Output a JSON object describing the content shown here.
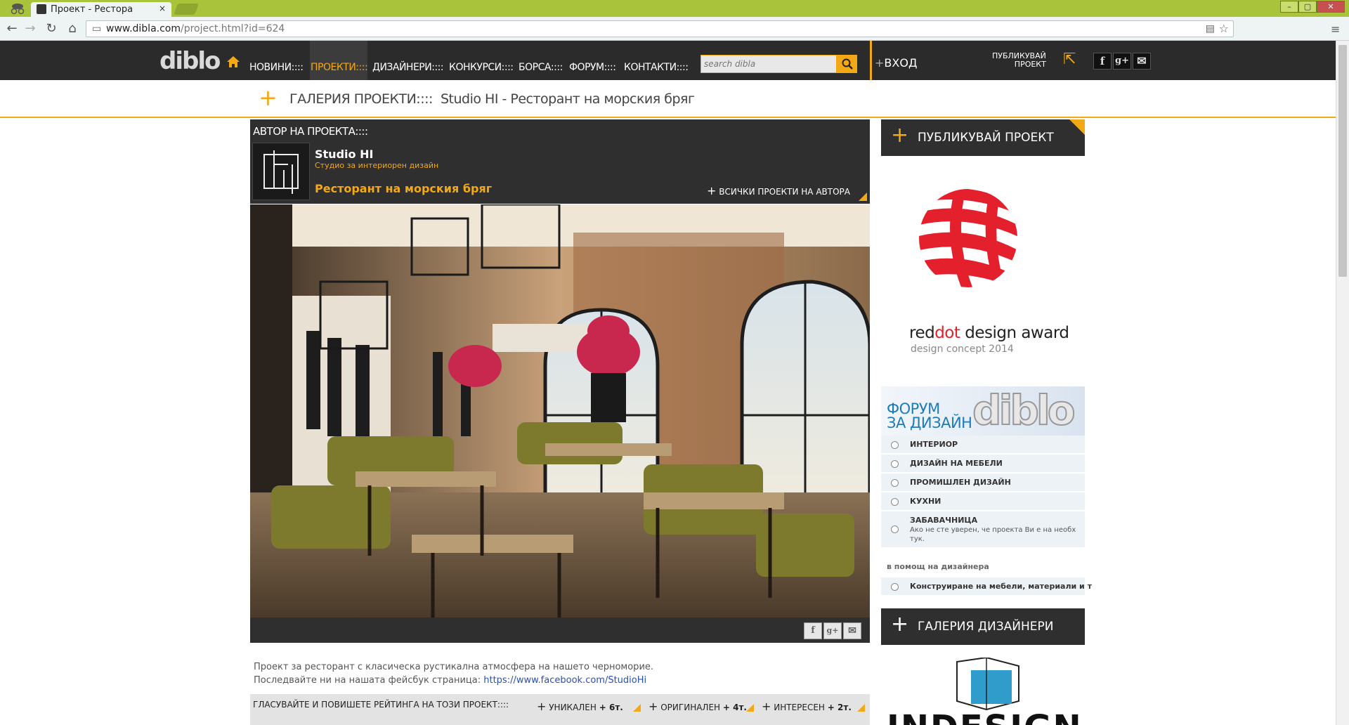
{
  "browser": {
    "tab_title": "Проект - Рестора",
    "tab_close": "×",
    "url_host": "www.dibla.com",
    "url_path": "/project.html?id=624",
    "back": "←",
    "forward": "→",
    "reload": "↻",
    "home": "⌂",
    "star": "☆",
    "menu": "≡",
    "win_min": "–",
    "win_max": "▢",
    "win_close": "✕"
  },
  "header": {
    "logo": "diblo",
    "nav": [
      "НОВИНИ::::",
      "ПРОЕКТИ::::",
      "ДИЗАЙНЕРИ::::",
      "КОНКУРСИ::::",
      "БОРСА::::",
      "ФОРУМ::::",
      "КОНТАКТИ::::"
    ],
    "search_placeholder": "search dibla",
    "login": "ВХОД",
    "publish_line1": "ПУБЛИКУВАЙ",
    "publish_line2": "ПРОЕКТ",
    "social": [
      "f",
      "g+",
      "✉"
    ],
    "accent": "#f3a816"
  },
  "breadcrumb": {
    "text": "ГАЛЕРИЯ ПРОЕКТИ::::  Studio HI - Ресторант на морския бряг"
  },
  "author": {
    "heading": "АВТОР НА ПРОЕКТА::::",
    "studio": "Studio HI",
    "studio_sub": "Студио за интериорен дизайн",
    "project_title": "Ресторант на морския бряг",
    "all_projects": "ВСИЧКИ ПРОЕКТИ НА АВТОРА"
  },
  "share": [
    "f",
    "g+",
    "✉"
  ],
  "description": {
    "line1": "Проект за ресторант с класическа рустикална атмосфера на нашето черноморие.",
    "line2_prefix": "Последвайте ни на нашата фейсбук страница: ",
    "link": "https://www.facebook.com/StudioHi"
  },
  "vote": {
    "label": "ГЛАСУВАЙТЕ И ПОВИШЕТЕ РЕЙТИНГА НА ТОЗИ ПРОЕКТ::::",
    "items": [
      {
        "label": "УНИКАЛЕН",
        "points": "+ 6т."
      },
      {
        "label": "ОРИГИНАЛЕН",
        "points": "+ 4т."
      },
      {
        "label": "ИНТЕРЕСЕН",
        "points": "+ 2т."
      }
    ]
  },
  "sidebar": {
    "publish": "ПУБЛИКУВАЙ ПРОЕКТ",
    "reddot_prefix": "red",
    "reddot_red": "dot",
    "reddot_suffix": " design award",
    "reddot_sub": "design concept 2014",
    "forum_title_1": "ФОРУМ",
    "forum_title_2": "ЗА ДИЗАЙН",
    "forum_logo": "diblo",
    "forum_items": [
      "ИНТЕРИОР",
      "ДИЗАЙН НА МЕБЕЛИ",
      "ПРОМИШЛЕН ДИЗАЙН",
      "КУХНИ",
      "ЗАБАВАЧНИЦА"
    ],
    "forum_fun_sub": "Ако не сте уверен, че проекта Ви е на необх тук.",
    "helper_label": "в помощ на дизайнера",
    "helper_item": "Конструиране на мебели, материали и т",
    "gallery": "ГАЛЕРИЯ ДИЗАЙНЕРИ",
    "indesign": "INDESIGN"
  }
}
